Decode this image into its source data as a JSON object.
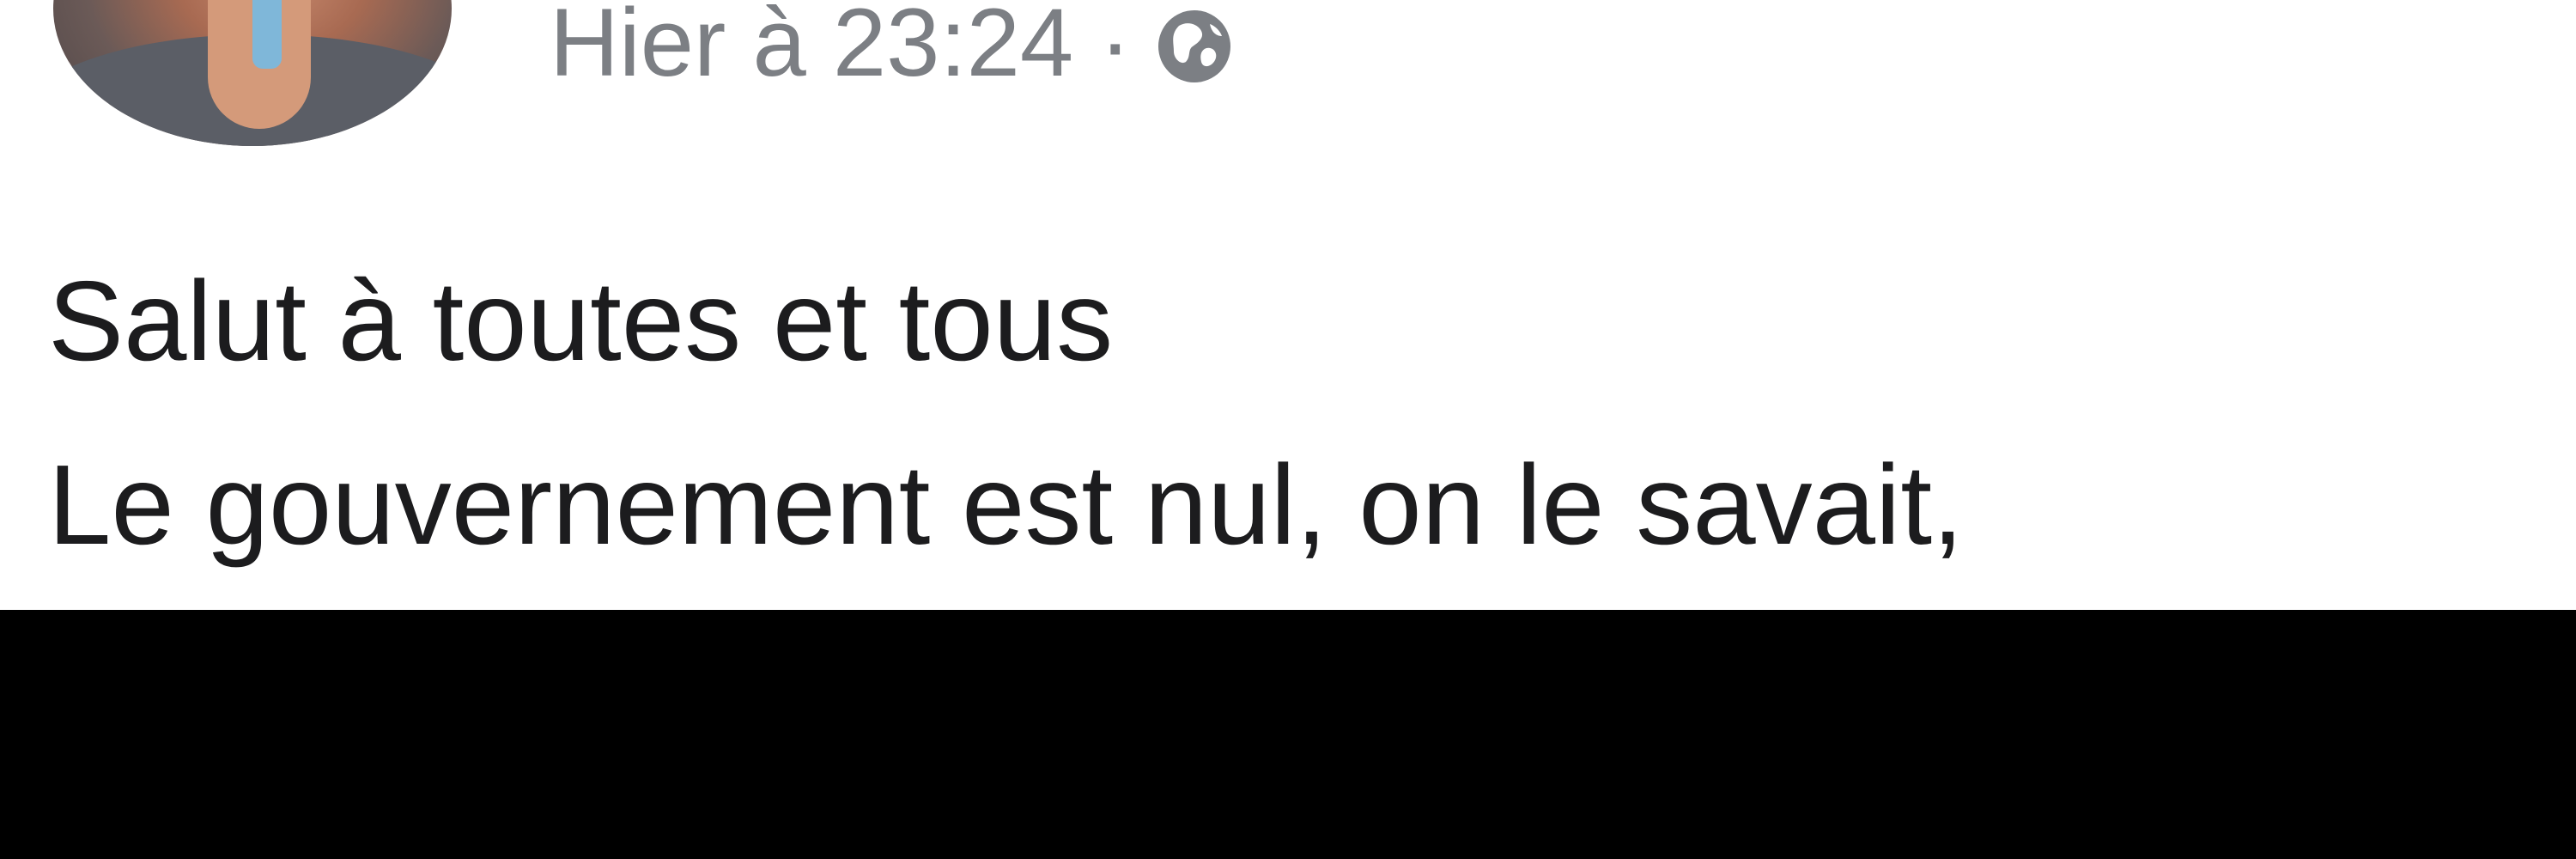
{
  "post": {
    "timestamp": "Hier à 23:24",
    "separator": "·",
    "privacy_icon": "globe-icon",
    "text_lines": [
      "Salut à toutes et tous",
      "Le gouvernement est nul, on le savait,"
    ]
  },
  "colors": {
    "background": "#ffffff",
    "meta_text": "#7c7f84",
    "body_text": "#1c1c1e",
    "redaction_bar": "#000000"
  }
}
